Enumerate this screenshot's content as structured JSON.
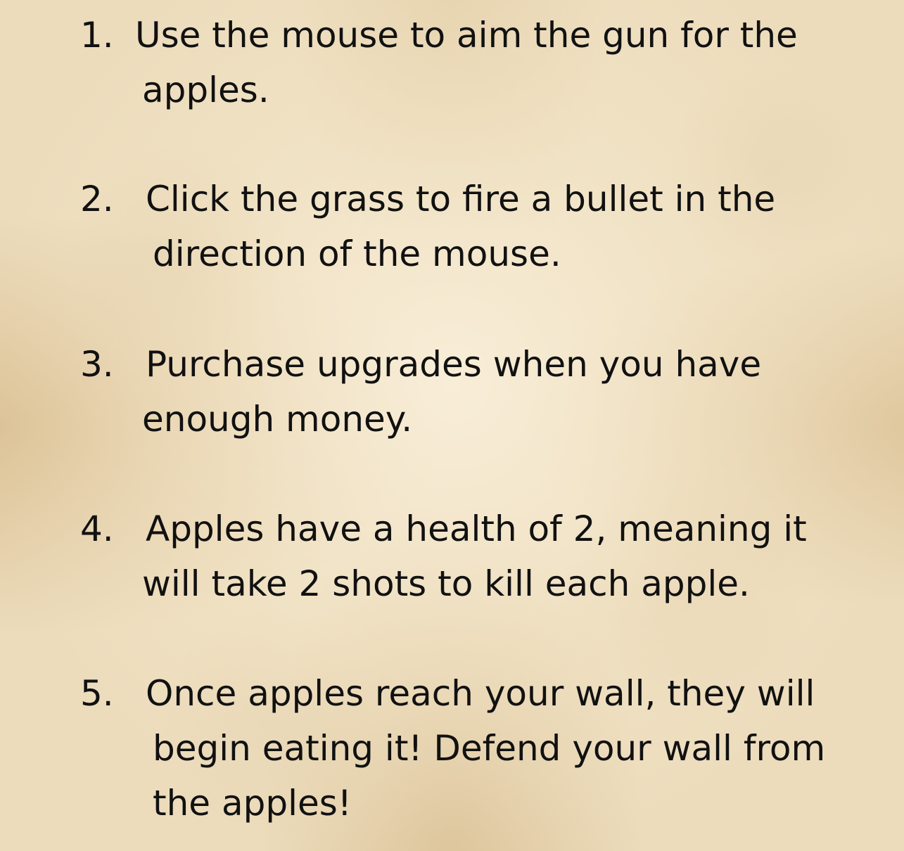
{
  "instructions": [
    {
      "number": "1.",
      "lines": [
        "Use the mouse to aim the gun for the",
        "apples."
      ]
    },
    {
      "number": "2.",
      "lines": [
        "Click the grass to fire a bullet in the",
        "direction of the mouse."
      ]
    },
    {
      "number": "3.",
      "lines": [
        "Purchase upgrades when you have",
        "enough money."
      ]
    },
    {
      "number": "4.",
      "lines": [
        "Apples have a health of 2, meaning it",
        "will take 2 shots to kill each apple."
      ]
    },
    {
      "number": "5.",
      "lines": [
        "Once apples reach your wall, they will",
        "begin eating it! Defend your wall from",
        "the apples!"
      ]
    }
  ]
}
